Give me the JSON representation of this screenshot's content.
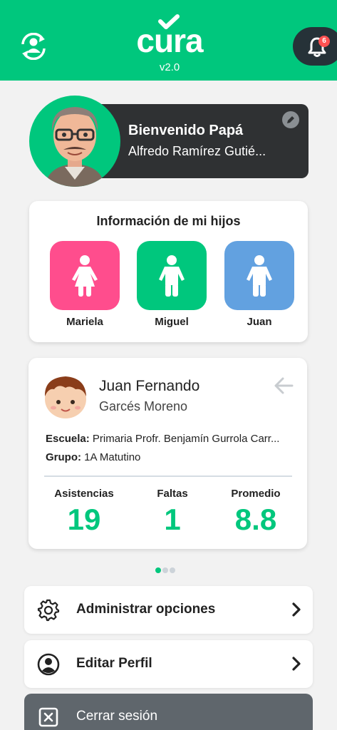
{
  "header": {
    "logo_text": "cura",
    "version": "v2.0",
    "notification_count": "6",
    "sync_icon": "account-sync-icon",
    "bell_icon": "bell-icon",
    "background": "#00c77d"
  },
  "welcome": {
    "title": "Bienvenido Papá",
    "name": "Alfredo Ramírez Gutié...",
    "edit_icon": "pencil-icon"
  },
  "children": {
    "title": "Información de mi hijos",
    "items": [
      {
        "name": "Mariela",
        "color": "#ff4d8d",
        "icon": "girl-icon"
      },
      {
        "name": "Miguel",
        "color": "#00c77d",
        "icon": "boy-icon"
      },
      {
        "name": "Juan",
        "color": "#62a1e0",
        "icon": "boy-icon"
      }
    ]
  },
  "student": {
    "first_name": "Juan Fernando",
    "last_name": "Garcés Moreno",
    "school_label": "Escuela:",
    "school_value": " Primaria Profr. Benjamín Gurrola Carr...",
    "group_label": "Grupo:",
    "group_value": " 1A Matutino",
    "stats": [
      {
        "label": "Asistencias",
        "value": "19"
      },
      {
        "label": "Faltas",
        "value": "1"
      },
      {
        "label": "Promedio",
        "value": "8.8"
      }
    ]
  },
  "pager": {
    "pages": 3,
    "active": 1
  },
  "menu": [
    {
      "label": "Administrar opciones",
      "icon": "gear-icon"
    },
    {
      "label": "Editar Perfil",
      "icon": "account-circle-icon"
    }
  ],
  "logout": {
    "label": "Cerrar sesión",
    "icon": "close-box-icon"
  },
  "colors": {
    "accent": "#00c77d",
    "dark": "#2f3133"
  }
}
